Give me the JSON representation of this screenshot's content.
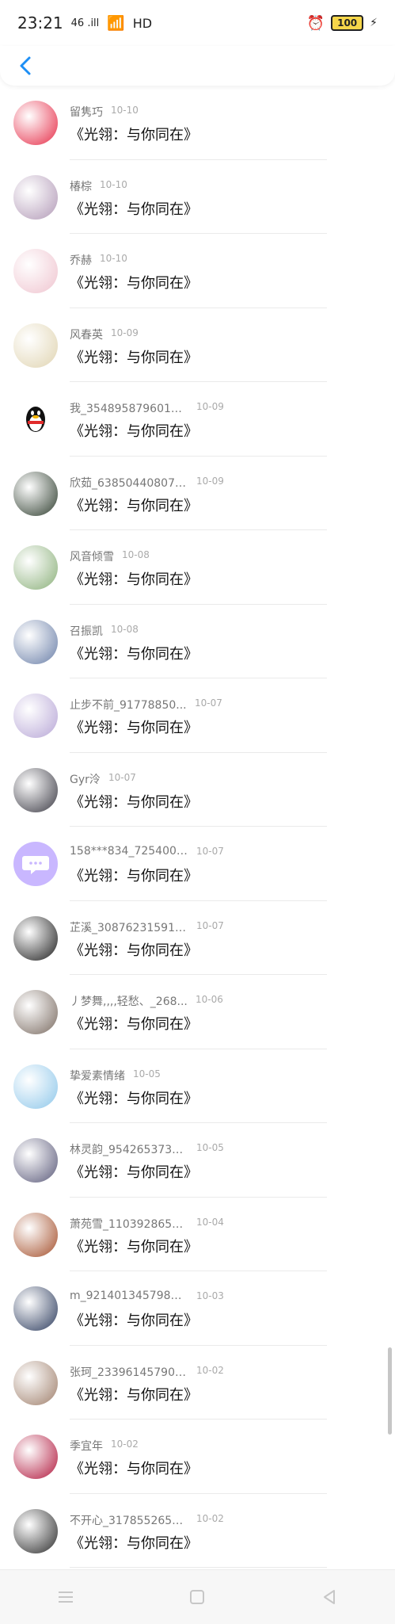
{
  "status": {
    "time": "23:21",
    "network": "46 .ill",
    "hd": "HD",
    "battery": "100"
  },
  "items": [
    {
      "name": "留隽巧",
      "date": "10-10",
      "content": "《光翎：与你同在》",
      "avatar_color": "#e62d48"
    },
    {
      "name": "椿棕",
      "date": "10-10",
      "content": "《光翎：与你同在》",
      "avatar_color": "#b29ab7"
    },
    {
      "name": "乔赫",
      "date": "10-10",
      "content": "《光翎：与你同在》",
      "avatar_color": "#efc4cf"
    },
    {
      "name": "风春英",
      "date": "10-09",
      "content": "《光翎：与你同在》",
      "avatar_color": "#e0d4b1"
    },
    {
      "name": "我_3548958796015...",
      "date": "10-09",
      "content": "《光翎：与你同在》",
      "avatar_color": "qq"
    },
    {
      "name": "欣茹_638504408074...",
      "date": "10-09",
      "content": "《光翎：与你同在》",
      "avatar_color": "#2f3e2f"
    },
    {
      "name": "风音倾雪",
      "date": "10-08",
      "content": "《光翎：与你同在》",
      "avatar_color": "#8bb07a"
    },
    {
      "name": "召振凯",
      "date": "10-08",
      "content": "《光翎：与你同在》",
      "avatar_color": "#6a7fa8"
    },
    {
      "name": "止步不前_91778850...",
      "date": "10-07",
      "content": "《光翎：与你同在》",
      "avatar_color": "#b7a6d6"
    },
    {
      "name": "Gyr泠",
      "date": "10-07",
      "content": "《光翎：与你同在》",
      "avatar_color": "#3b3a44"
    },
    {
      "name": "158***834_7254007...",
      "date": "10-07",
      "content": "《光翎：与你同在》",
      "avatar_color": "bubble"
    },
    {
      "name": "芷溪_308762315914...",
      "date": "10-07",
      "content": "《光翎：与你同在》",
      "avatar_color": "#1d1d1d"
    },
    {
      "name": "丿梦舞,,,,轻愁、_268...",
      "date": "10-06",
      "content": "《光翎：与你同在》",
      "avatar_color": "#7a6b61"
    },
    {
      "name": "挚爱素情绪",
      "date": "10-05",
      "content": "《光翎：与你同在》",
      "avatar_color": "#8ec7ea"
    },
    {
      "name": "林灵韵_9542653730...",
      "date": "10-05",
      "content": "《光翎：与你同在》",
      "avatar_color": "#5b5a7a"
    },
    {
      "name": "萧苑雪_1103928655...",
      "date": "10-04",
      "content": "《光翎：与你同在》",
      "avatar_color": "#a44f2b"
    },
    {
      "name": "m_92140134579846...",
      "date": "10-03",
      "content": "《光翎：与你同在》",
      "avatar_color": "#2d3c5e"
    },
    {
      "name": "张珂_233961457907...",
      "date": "10-02",
      "content": "《光翎：与你同在》",
      "avatar_color": "#9f7f6b"
    },
    {
      "name": "季宜年",
      "date": "10-02",
      "content": "《光翎：与你同在》",
      "avatar_color": "#b1183d"
    },
    {
      "name": "不开心_3178552656...",
      "date": "10-02",
      "content": "《光翎：与你同在》",
      "avatar_color": "#2b2b2b"
    }
  ],
  "accent": "#1e8ff5"
}
